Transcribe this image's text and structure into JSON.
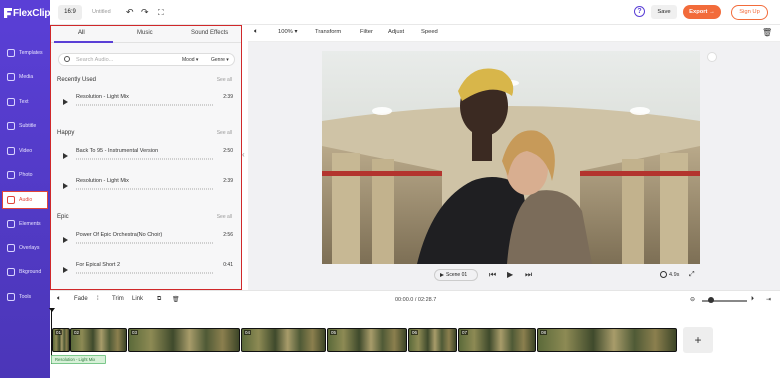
{
  "app": {
    "brand": "FlexClip",
    "aspect_ratio": "16:9",
    "project_title": "Untitled",
    "save_label": "Save",
    "export_label": "Export",
    "signup_label": "Sign Up",
    "accent_color": "#5a3fd6",
    "export_color": "#f26b3a",
    "highlight_color": "#d0282a"
  },
  "sidebar": {
    "items": [
      {
        "label": "Templates",
        "icon": "templates-icon"
      },
      {
        "label": "Media",
        "icon": "media-icon"
      },
      {
        "label": "Text",
        "icon": "text-icon"
      },
      {
        "label": "Subtitle",
        "icon": "subtitle-icon"
      },
      {
        "label": "Video",
        "icon": "video-icon"
      },
      {
        "label": "Photo",
        "icon": "photo-icon"
      },
      {
        "label": "Audio",
        "icon": "audio-icon",
        "active": true
      },
      {
        "label": "Elements",
        "icon": "elements-icon"
      },
      {
        "label": "Overlays",
        "icon": "overlays-icon"
      },
      {
        "label": "Bkground",
        "icon": "background-icon"
      },
      {
        "label": "Tools",
        "icon": "tools-icon"
      }
    ]
  },
  "audio_panel": {
    "tabs": [
      "All",
      "Music",
      "Sound Effects"
    ],
    "active_tab": "All",
    "search_placeholder": "Search Audio...",
    "filter_mood": "Mood",
    "filter_genre": "Genre",
    "see_all": "See all",
    "sections": [
      {
        "title": "Recently Used",
        "tracks": [
          {
            "name": "Resolution - Light Mix",
            "duration": "2:39"
          }
        ]
      },
      {
        "title": "Happy",
        "tracks": [
          {
            "name": "Back To 95 - Instrumental Version",
            "duration": "2:50"
          },
          {
            "name": "Resolution - Light Mix",
            "duration": "2:39"
          }
        ]
      },
      {
        "title": "Epic",
        "tracks": [
          {
            "name": "Power Of Epic Orchestra(No Choir)",
            "duration": "2:56"
          },
          {
            "name": "For Epical Short 2",
            "duration": "0:41"
          }
        ]
      }
    ]
  },
  "editor_toolbar": {
    "zoom": "100%",
    "items": [
      "Transform",
      "Filter",
      "Adjust",
      "Speed"
    ]
  },
  "playback": {
    "scene_label": "Scene 01",
    "scene_duration": "4.9s"
  },
  "timeline": {
    "fade_label": "Fade",
    "trim_label": "Trim",
    "link_label": "Link",
    "time_display": "00:00.0 / 02:28.7",
    "zoom_level": 0.15,
    "clip_numbers": [
      "01",
      "02",
      "03",
      "04",
      "05",
      "06",
      "07",
      "08"
    ],
    "audio_label": "Resolution - Light Mix"
  }
}
